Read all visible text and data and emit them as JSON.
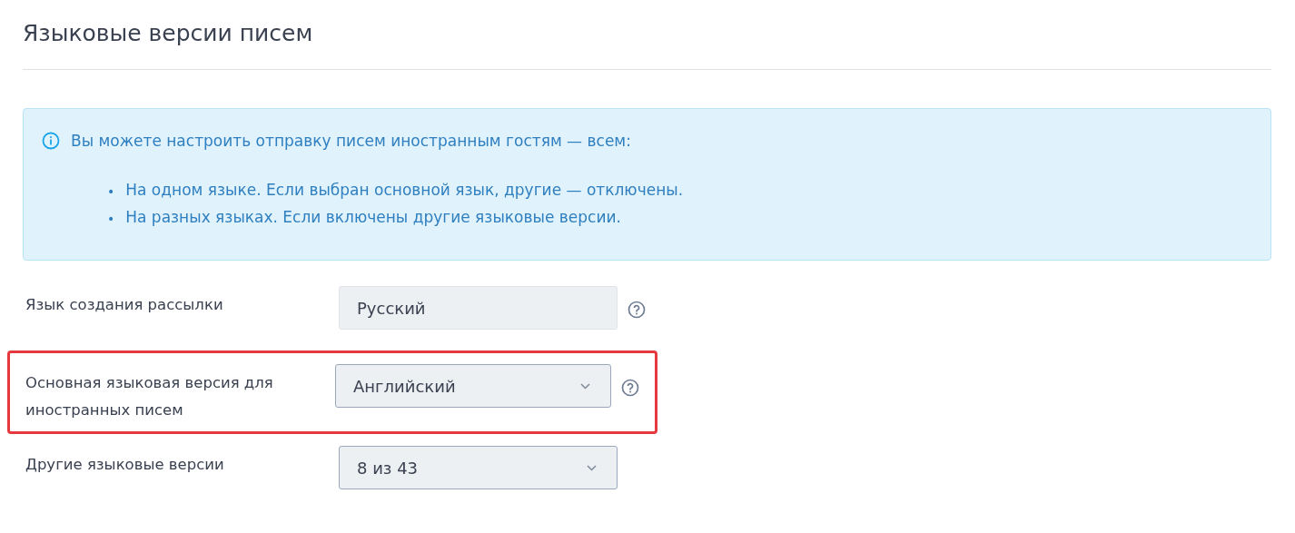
{
  "title": "Языковые версии писем",
  "info": {
    "text": "Вы можете настроить отправку писем иностранным гостям — всем:",
    "bullets": [
      {
        "marker": "•",
        "text": "На одном языке. Если выбран основной язык, другие — отключены."
      },
      {
        "marker": "•",
        "text": "На разных языках. Если включены другие языковые версии."
      }
    ]
  },
  "fields": [
    {
      "label": "Язык создания рассылки",
      "kind": "readonly",
      "value": "Русский",
      "help": true,
      "highlighted": false
    },
    {
      "label": "Основная языковая версия для иностранных писем",
      "kind": "select",
      "value": "Английский",
      "help": true,
      "highlighted": true
    },
    {
      "label": "Другие языковые версии",
      "kind": "select",
      "value": "8 из 43",
      "help": false,
      "highlighted": false
    }
  ]
}
